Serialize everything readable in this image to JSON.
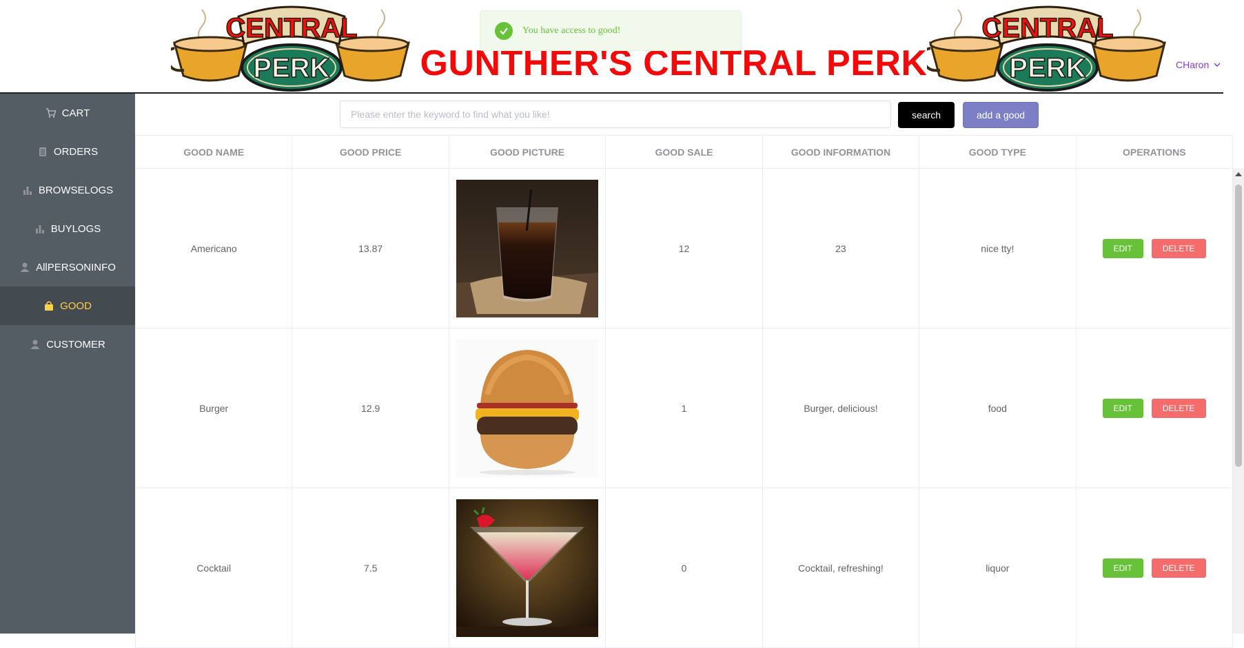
{
  "header": {
    "title": "GUNTHER'S CENTRAL PERK",
    "logo_text_top": "CENTRAL",
    "logo_text_bottom": "PERK",
    "user_name": "CHaron"
  },
  "toast": {
    "message": "You have access to good!"
  },
  "sidebar": {
    "items": [
      {
        "label": "CART",
        "icon": "cart-icon"
      },
      {
        "label": "ORDERS",
        "icon": "clipboard-icon"
      },
      {
        "label": "BROWSELOGS",
        "icon": "bar-chart-icon"
      },
      {
        "label": "BUYLOGS",
        "icon": "bar-chart-icon"
      },
      {
        "label": "AllPERSONINFO",
        "icon": "user-icon"
      },
      {
        "label": "GOOD",
        "icon": "shopping-bag-icon",
        "active": true
      },
      {
        "label": "CUSTOMER",
        "icon": "user-icon"
      }
    ]
  },
  "toolbar": {
    "search_placeholder": "Please enter the keyword to find what you like!",
    "search_label": "search",
    "add_label": "add a good"
  },
  "table": {
    "headers": [
      "GOOD NAME",
      "GOOD PRICE",
      "GOOD PICTURE",
      "GOOD SALE",
      "GOOD INFORMATION",
      "GOOD TYPE",
      "OPERATIONS"
    ],
    "rows": [
      {
        "name": "Americano",
        "price": "13.87",
        "picture": "americano-photo",
        "sale": "12",
        "info": "23",
        "type": "nice tty!"
      },
      {
        "name": "Burger",
        "price": "12.9",
        "picture": "burger-photo",
        "sale": "1",
        "info": "Burger, delicious!",
        "type": "food"
      },
      {
        "name": "Cocktail",
        "price": "7.5",
        "picture": "cocktail-photo",
        "sale": "0",
        "info": "Cocktail, refreshing!",
        "type": "liquor"
      }
    ],
    "edit_label": "EDIT",
    "delete_label": "DELETE"
  },
  "colors": {
    "sidebar_bg": "#545c64",
    "sidebar_active": "#ffd04b",
    "title_red": "#f20a0a",
    "edit_green": "#67c23a",
    "delete_red": "#f56c6c",
    "add_purple": "#7b7fc6"
  }
}
